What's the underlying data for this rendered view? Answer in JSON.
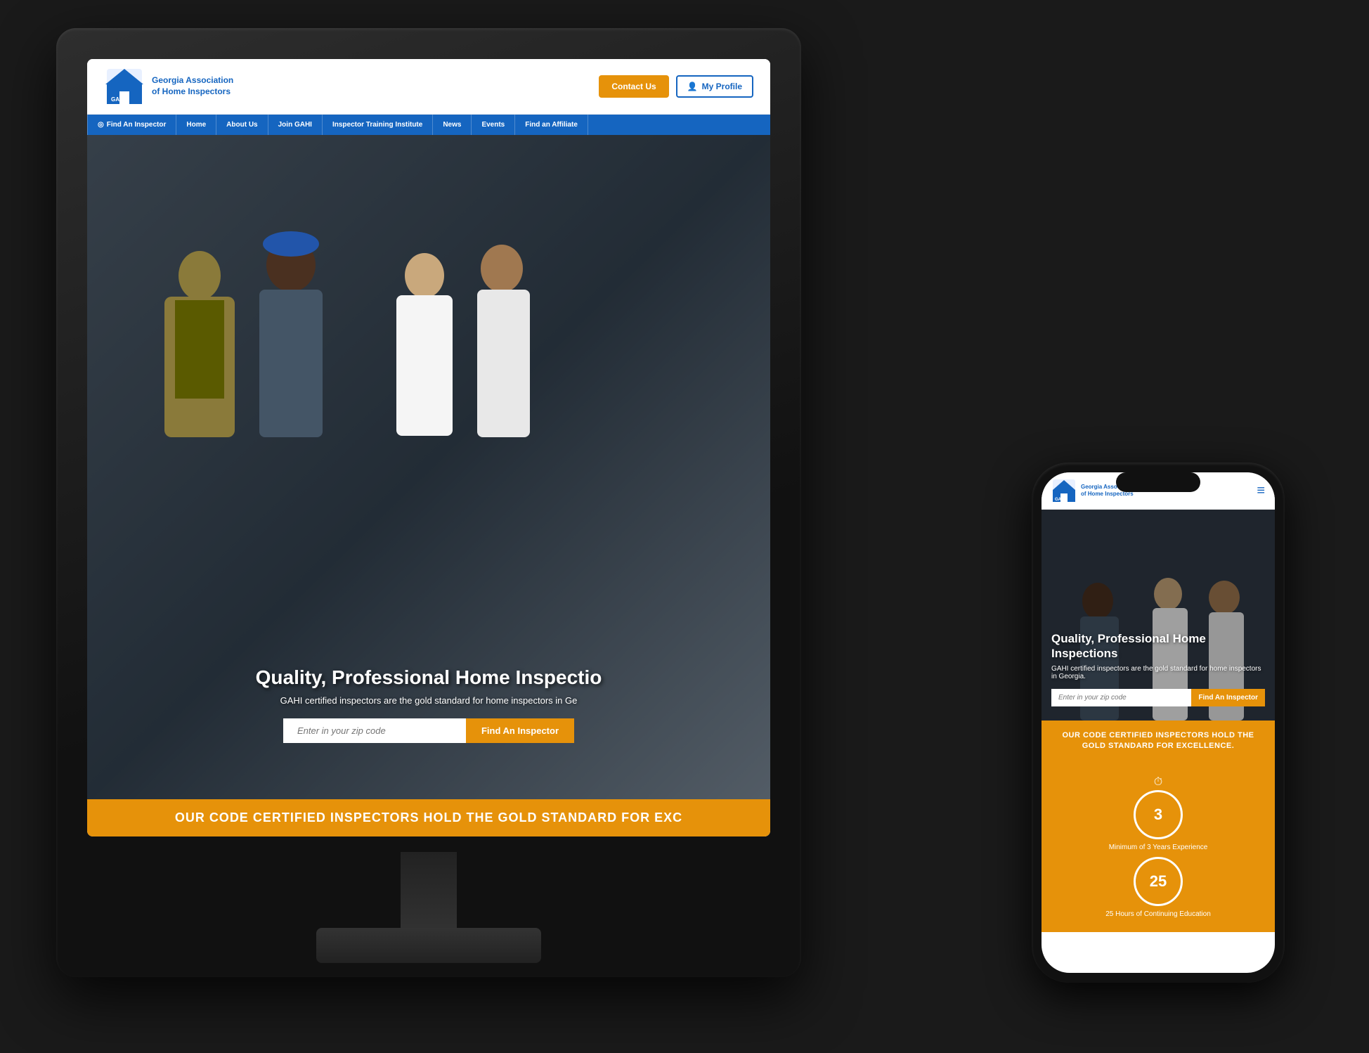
{
  "scene": {
    "background": "#1a1a1a"
  },
  "desktop": {
    "header": {
      "logo_org": "GAHI",
      "logo_line1": "Georgia Association",
      "logo_line2": "of Home Inspectors",
      "contact_btn": "Contact Us",
      "profile_btn": "My Profile"
    },
    "nav": {
      "items": [
        {
          "label": "Find An Inspector",
          "has_icon": true
        },
        {
          "label": "Home"
        },
        {
          "label": "About Us"
        },
        {
          "label": "Join GAHI"
        },
        {
          "label": "Inspector Training Institute"
        },
        {
          "label": "News"
        },
        {
          "label": "Events"
        },
        {
          "label": "Find an Affiliate"
        }
      ]
    },
    "hero": {
      "title": "Quality, Professional Home Inspectio",
      "subtitle": "GAHI certified inspectors are the gold standard for home inspectors in Ge",
      "input_placeholder": "Enter in your zip code",
      "find_btn": "Find An Inspector"
    },
    "banner": {
      "text": "OUR CODE CERTIFIED INSPECTORS HOLD THE GOLD STANDARD FOR EXC"
    }
  },
  "mobile": {
    "header": {
      "logo_org": "GAHI",
      "logo_line1": "Georgia Association",
      "logo_line2": "of Home Inspectors",
      "menu_icon": "≡"
    },
    "hero": {
      "title": "Quality, Professional Home Inspections",
      "subtitle": "GAHI certified inspectors are the gold standard for home inspectors in Georgia.",
      "input_placeholder": "Enter in your zip code",
      "find_btn": "Find An Inspector"
    },
    "banner": {
      "text": "OUR CODE CERTIFIED INSPECTORS HOLD THE GOLD STANDARD FOR EXCELLENCE."
    },
    "stats": [
      {
        "number": "3",
        "label": "Minimum of 3 Years Experience",
        "has_timer": true
      },
      {
        "number": "25",
        "label": "25 Hours of Continuing Education"
      }
    ]
  },
  "icons": {
    "search": "◎",
    "user": "👤",
    "timer": "⏱",
    "hamburger": "≡"
  }
}
